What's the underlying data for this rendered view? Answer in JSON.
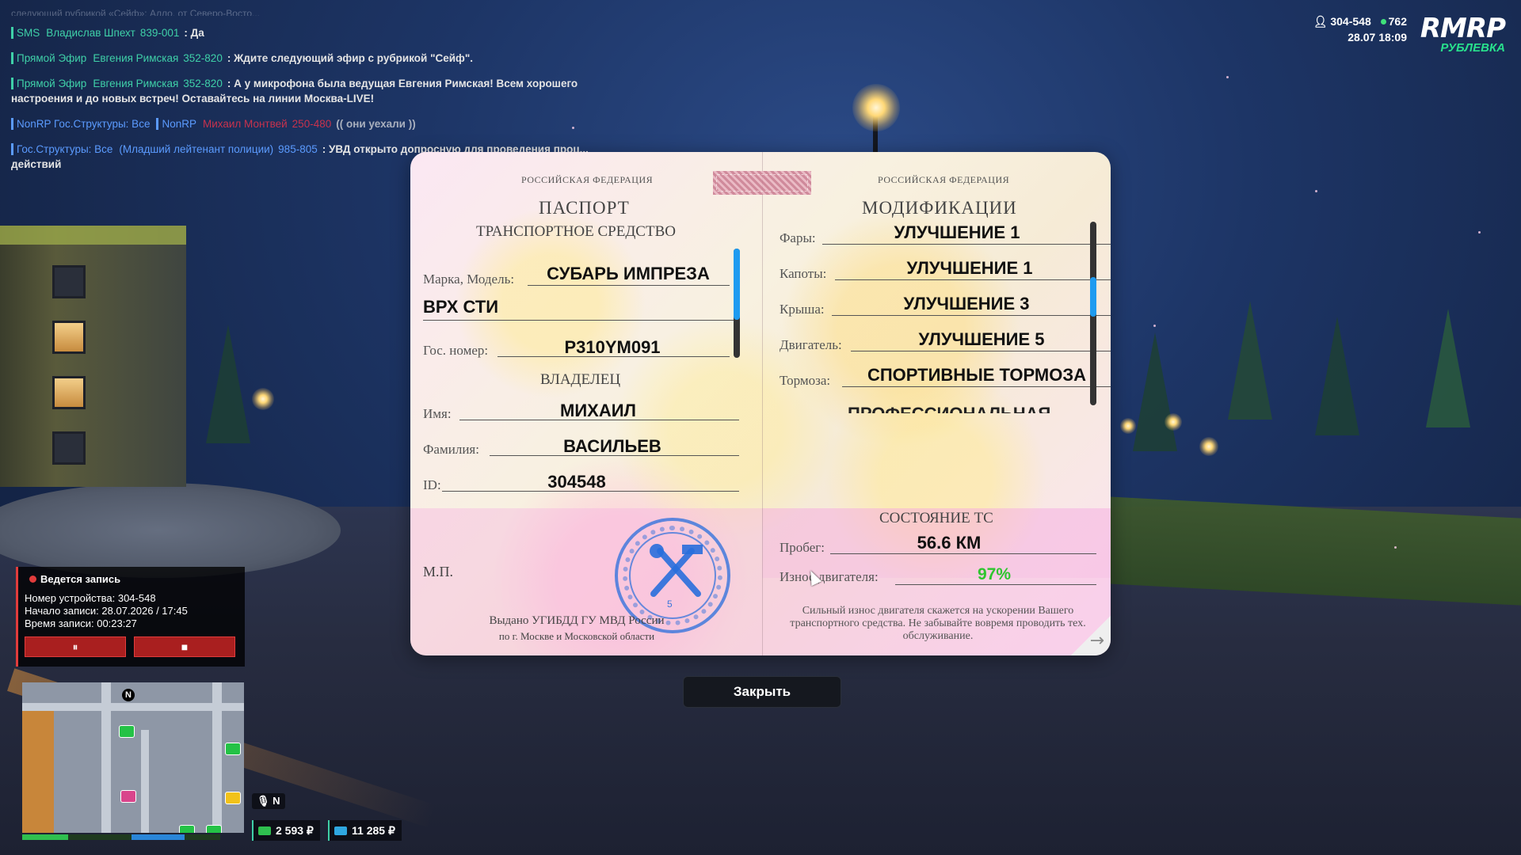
{
  "chat": {
    "top_fragment": "следующий рубрикой «Сейф»: Алло, от Северо-Восто...",
    "lines": [
      {
        "channel": "SMS",
        "name": "Владислав Шпехт",
        "number": "839-001",
        "text": ": Да"
      },
      {
        "channel": "Прямой Эфир",
        "name": "Евгения Римская",
        "number": "352-820",
        "text": ": Ждите следующий эфир с рубрикой \"Сейф\"."
      },
      {
        "channel": "Прямой Эфир",
        "name": "Евгения Римская",
        "number": "352-820",
        "text": ": А у микрофона была ведущая Евгения Римская! Всем хорошего настроения и до новых встреч! Оставайтесь на линии Москва-LIVE!"
      },
      {
        "channel": "NonRP Гос.Структуры: Все",
        "channel2": "NonRP",
        "name": "Михаил Монтвей",
        "number": "250-480",
        "text": "(( они уехали ))"
      },
      {
        "channel": "Гос.Структуры: Все",
        "name": "(Младший лейтенант полиции)",
        "number": "985-805",
        "text": ": УВД открыто допросную для проведения проц... действий"
      }
    ]
  },
  "hud": {
    "player_id": "304-548",
    "online": "762",
    "date": "28.07",
    "time": "18:09",
    "logo": "RMRP",
    "server": "РУБЛЕВКА"
  },
  "passport": {
    "country_left": "РОССИЙСКАЯ ФЕДЕРАЦИЯ",
    "country_right": "РОССИЙСКАЯ ФЕДЕРАЦИЯ",
    "title": "ПАСПОРТ",
    "subtitle": "ТРАНСПОРТНОЕ СРЕДСТВО",
    "make_label": "Марка, Модель:",
    "make_value_1": "СУБАРЬ ИМПРЕЗА",
    "make_value_2": "ВРХ СТИ",
    "plate_label": "Гос. номер:",
    "plate_value": "Р310YM091",
    "owner_heading": "ВЛАДЕЛЕЦ",
    "first_name_label": "Имя:",
    "first_name_value": "МИХАИЛ",
    "last_name_label": "Фамилия:",
    "last_name_value": "ВАСИЛЬЕВ",
    "id_label": "ID:",
    "id_value": "304548",
    "mp_label": "М.П.",
    "issued_line_1": "Выдано УГИБДД ГУ МВД России",
    "issued_line_2": "по г. Москве и Московской области",
    "stamp_number": "5",
    "mods_title": "МОДИФИКАЦИИ",
    "mods": [
      {
        "label": "Фары:",
        "value": "УЛУЧШЕНИЕ 1"
      },
      {
        "label": "Капоты:",
        "value": "УЛУЧШЕНИЕ 1"
      },
      {
        "label": "Крыша:",
        "value": "УЛУЧШЕНИЕ 3"
      },
      {
        "label": "Двигатель:",
        "value": "УЛУЧШЕНИЕ 5"
      },
      {
        "label": "Тормоза:",
        "value": "СПОРТИВНЫЕ ТОРМОЗА"
      }
    ],
    "mods_cut_value": "ПРОФЕССИОНАЛЬНАЯ",
    "state_title": "СОСТОЯНИЕ ТС",
    "mileage_label": "Пробег:",
    "mileage_value": "56.6 КМ",
    "wear_label": "Износ двигателя:",
    "wear_value": "97%",
    "note": "Сильный износ двигателя скажется на ускорении Вашего транспортного средства. Не забывайте вовремя проводить тех. обслуживание.",
    "close_label": "Закрыть"
  },
  "recorder": {
    "title": "Ведется запись",
    "device_label": "Номер устройства:",
    "device_value": "304-548",
    "start_label": "Начало записи:",
    "start_value": "28.07.2026 / 17:45",
    "duration_label": "Время записи:",
    "duration_value": "00:23:27",
    "pause_icon": "⏸",
    "stop_icon": "■"
  },
  "minimap": {
    "north": "N",
    "mic_state": "N",
    "health_fraction": 0.42,
    "armor_fraction": 0.6
  },
  "money": {
    "cash": "2 593 ₽",
    "bank": "11 285 ₽"
  },
  "colors": {
    "accent": "#3fd0a8",
    "brand_green": "#28e08c",
    "record_red": "#e23c3c"
  }
}
